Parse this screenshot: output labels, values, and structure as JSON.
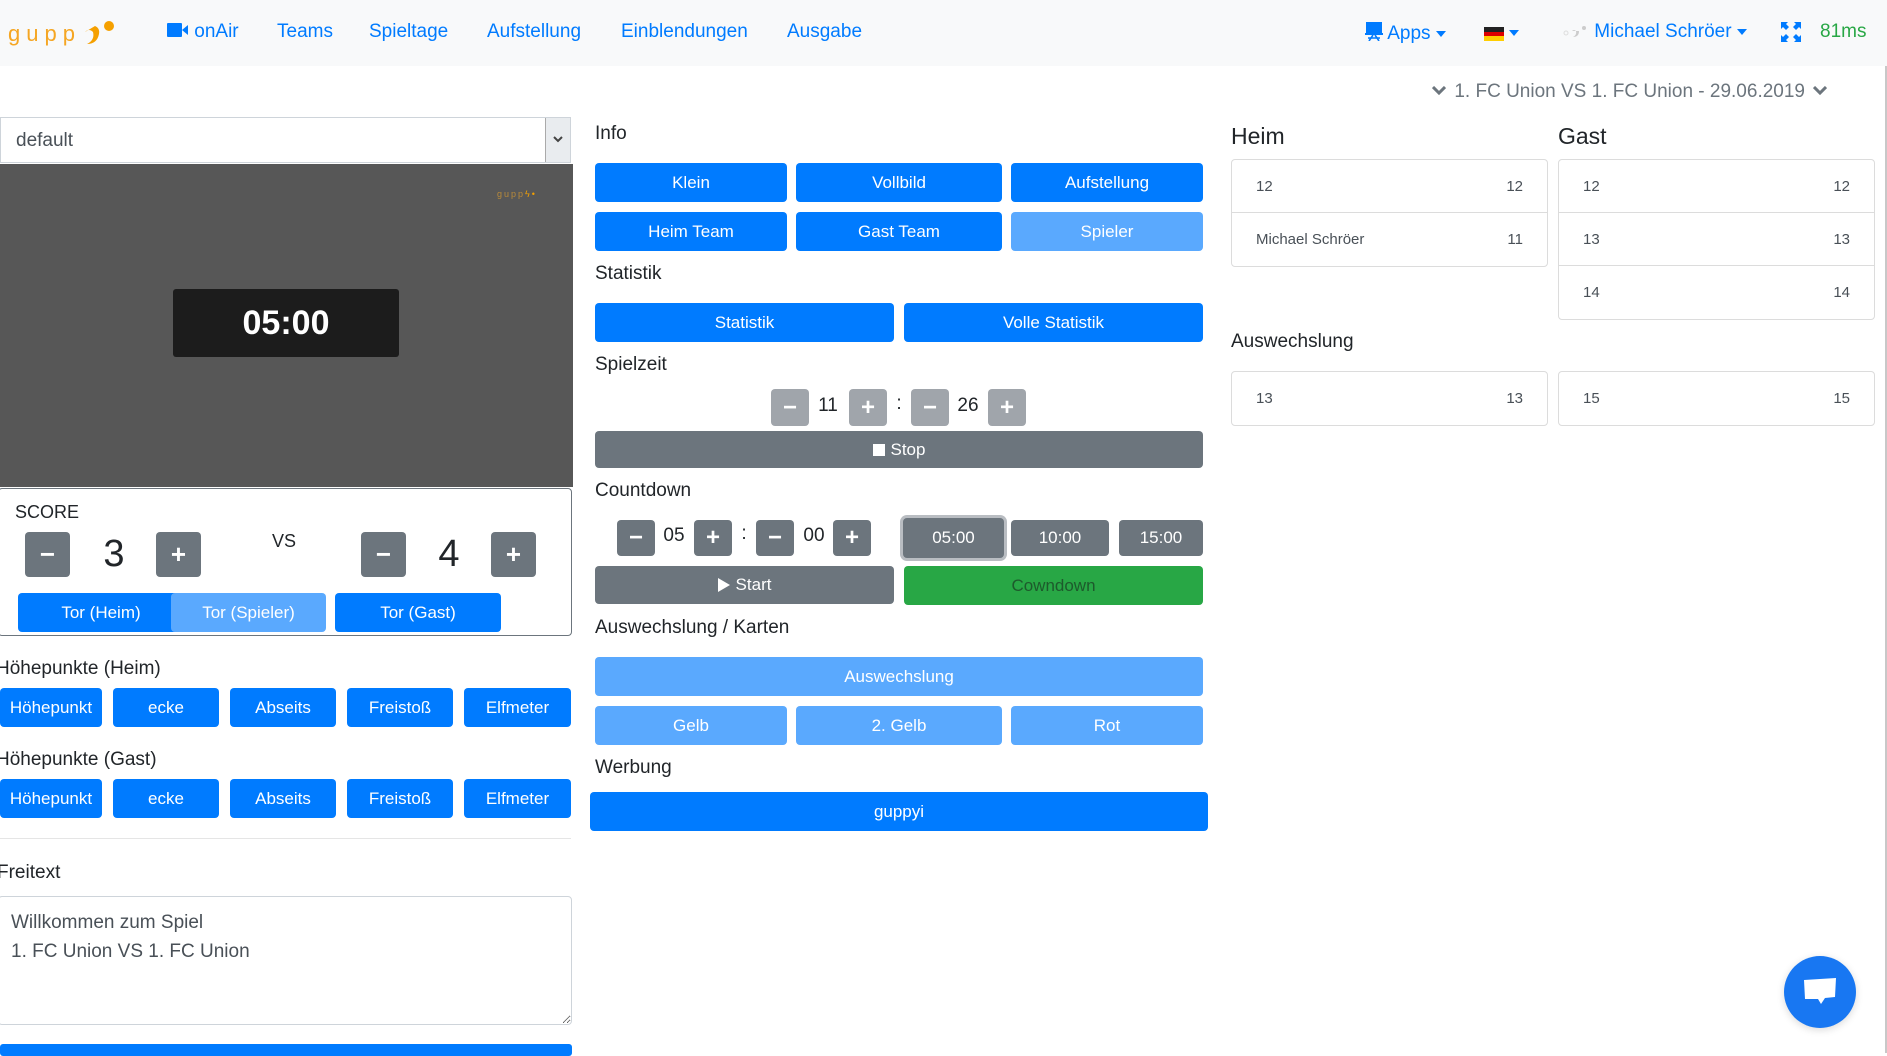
{
  "nav": {
    "logo_text": "gupp",
    "items": [
      {
        "label": "onAir",
        "icon": "video-camera-icon"
      },
      {
        "label": "Teams"
      },
      {
        "label": "Spieltage"
      },
      {
        "label": "Aufstellung"
      },
      {
        "label": "Einblendungen"
      },
      {
        "label": "Ausgabe"
      }
    ],
    "apps_label": "Apps",
    "language": "DE",
    "user_name": "Michael Schröer",
    "latency": "81ms"
  },
  "match_selector": "1. FC Union VS 1. FC Union - 29.06.2019",
  "left": {
    "template_select": "default",
    "preview": {
      "timer": "05:00",
      "logo_text": "gupp"
    },
    "score": {
      "title": "SCORE",
      "home": "3",
      "away": "4",
      "vs": "VS",
      "minus": "−",
      "plus": "+",
      "buttons": [
        "Tor (Heim)",
        "Tor (Spieler)",
        "Tor (Gast)"
      ]
    },
    "highlights_home": {
      "title": "Höhepunkte (Heim)",
      "buttons": [
        "Höhepunkt",
        "ecke",
        "Abseits",
        "Freistoß",
        "Elfmeter"
      ]
    },
    "highlights_away": {
      "title": "Höhepunkte (Gast)",
      "buttons": [
        "Höhepunkt",
        "ecke",
        "Abseits",
        "Freistoß",
        "Elfmeter"
      ]
    },
    "freitext": {
      "title": "Freitext",
      "value": "Willkommen zum Spiel\n1. FC Union VS 1. FC Union"
    }
  },
  "middle": {
    "info": {
      "title": "Info",
      "buttons": [
        "Klein",
        "Vollbild",
        "Aufstellung",
        "Heim Team",
        "Gast Team",
        "Spieler"
      ]
    },
    "statistik": {
      "title": "Statistik",
      "buttons": [
        "Statistik",
        "Volle Statistik"
      ]
    },
    "spielzeit": {
      "title": "Spielzeit",
      "minutes": "11",
      "seconds": "26",
      "separator": ":",
      "stop_label": "Stop"
    },
    "countdown": {
      "title": "Countdown",
      "minutes": "05",
      "seconds": "00",
      "separator": ":",
      "presets": [
        "05:00",
        "10:00",
        "15:00"
      ],
      "selected_preset": "05:00",
      "start_label": "Start",
      "countdown_label": "Cowndown"
    },
    "cards": {
      "title": "Auswechslung / Karten",
      "substitution_label": "Auswechslung",
      "buttons": [
        "Gelb",
        "2. Gelb",
        "Rot"
      ]
    },
    "werbung": {
      "title": "Werbung",
      "button": "guppyi"
    }
  },
  "right": {
    "home_title": "Heim",
    "away_title": "Gast",
    "home_players": [
      {
        "name": "12",
        "number": "12"
      },
      {
        "name": "Michael Schröer",
        "number": "11"
      }
    ],
    "away_players": [
      {
        "name": "12",
        "number": "12"
      },
      {
        "name": "13",
        "number": "13"
      },
      {
        "name": "14",
        "number": "14"
      }
    ],
    "substitution_title": "Auswechslung",
    "home_subs": [
      {
        "name": "13",
        "number": "13"
      }
    ],
    "away_subs": [
      {
        "name": "15",
        "number": "15"
      }
    ]
  }
}
